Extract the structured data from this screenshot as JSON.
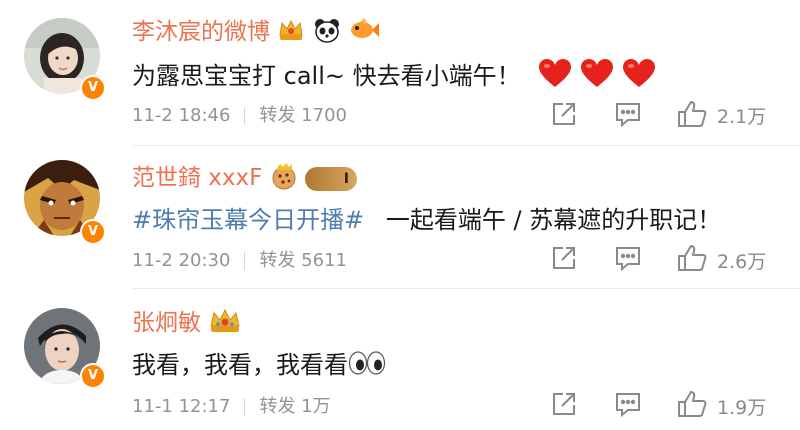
{
  "comments": [
    {
      "username": "李沐宸的微博",
      "badge_icons": [
        "crown-badge-icon",
        "panda-icon",
        "fish-icon"
      ],
      "content": "为露思宝宝打 call~ 快去看小端午！",
      "emoji": [
        "heart-icon",
        "heart-icon",
        "heart-icon"
      ],
      "time": "11-2 18:46",
      "repost": "转发 1700",
      "likes": "2.1万",
      "verified": "V"
    },
    {
      "username": "范世錡 xxxF",
      "badge_icons": [
        "cookie-badge-icon"
      ],
      "level": "I",
      "topic": "#珠帘玉幕今日开播#",
      "content": "一起看端午 / 苏幕遮的升职记！",
      "time": "11-2 20:30",
      "repost": "转发 5611",
      "likes": "2.6万",
      "verified": "V"
    },
    {
      "username": "张炯敏",
      "badge_icons": [
        "crown-badge-icon"
      ],
      "content": "我看，我看，我看看",
      "emoji": [
        "eyes-icon"
      ],
      "time": "11-1 12:17",
      "repost": "转发 1万",
      "likes": "1.9万",
      "verified": "V"
    }
  ],
  "colors": {
    "username": "#eb7350",
    "topic": "#507daf",
    "meta": "#939393",
    "verified_badge": "#ff8200",
    "heart": "#e5231c"
  }
}
